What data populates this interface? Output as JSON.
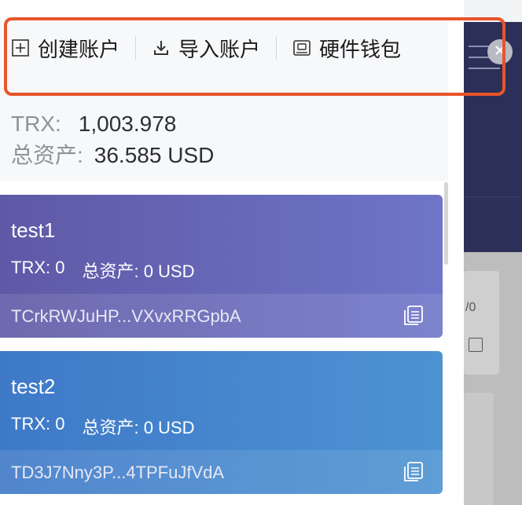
{
  "toolbar": {
    "create_account": "创建账户",
    "import_account": "导入账户",
    "hardware_wallet": "硬件钱包"
  },
  "summary": {
    "trx_label": "TRX:",
    "trx_value": "1,003.978",
    "total_label": "总资产:",
    "total_value": "36.585 USD"
  },
  "accounts": [
    {
      "name": "test1",
      "trx": "TRX: 0",
      "total": "总资产: 0 USD",
      "address": "TCrkRWJuHP...VXvxRRGpbA"
    },
    {
      "name": "test2",
      "trx": "TRX: 0",
      "total": "总资产: 0 USD",
      "address": "TD3J7Nny3P...4TPFuJfVdA"
    }
  ],
  "background": {
    "fraction_text": "/0"
  },
  "colors": {
    "highlight": "#e8542a",
    "card1": "#6f75c8",
    "card2": "#4d93d2"
  }
}
